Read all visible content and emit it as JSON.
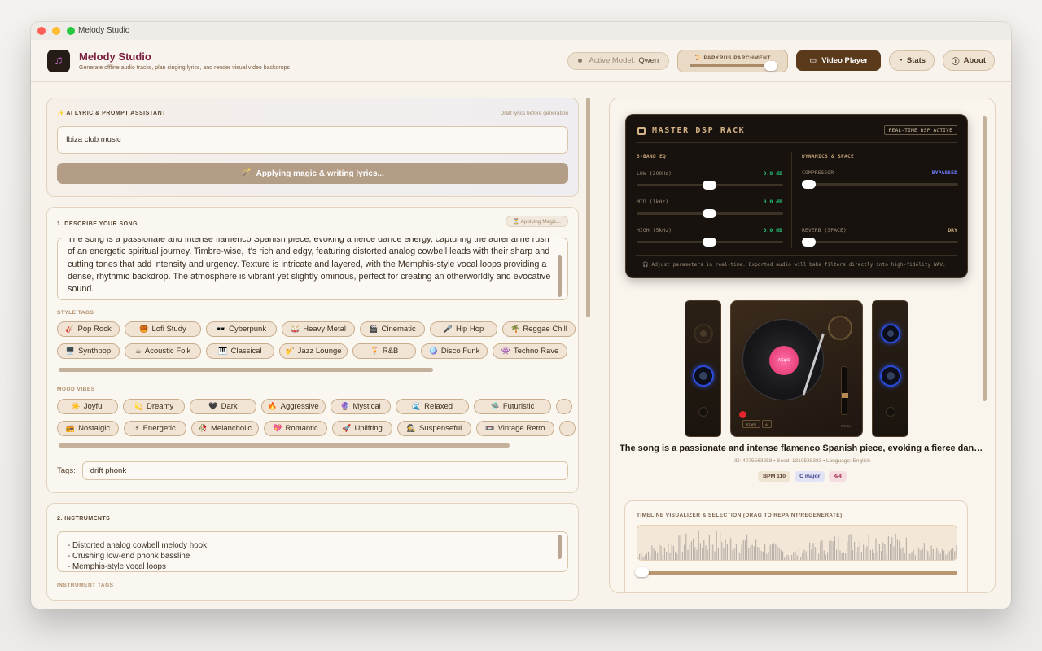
{
  "window": {
    "title": "Melody Studio"
  },
  "header": {
    "title": "Melody Studio",
    "subtitle": "Generate offline audio tracks, plan singing lyrics, and render visual video backdrops",
    "model_label": "Active Model:",
    "model_value": "Qwen",
    "theme_label": "📜 PAPYRUS PARCHMENT",
    "video_player": "Video Player",
    "stats": "Stats",
    "about": "About"
  },
  "lyric_assistant": {
    "label": "✨ AI LYRIC & PROMPT ASSISTANT",
    "note": "Draft lyrics before generation",
    "prompt_value": "Ibiza club music",
    "button": "Applying magic & writing lyrics..."
  },
  "describe": {
    "label": "1. DESCRIBE YOUR SONG",
    "status": "⏳ Applying Magic...",
    "text": "The song is a passionate and intense flamenco Spanish piece, evoking a fierce dance energy, capturing the adrenaline rush of an energetic spiritual journey. Timbre-wise, it's rich and edgy, featuring distorted analog cowbell leads with their sharp and cutting tones that add intensity and urgency. Texture is intricate and layered, with the Memphis-style vocal loops providing a dense, rhythmic backdrop. The atmosphere is vibrant yet slightly ominous, perfect for creating an otherworldly and evocative sound.",
    "style_label": "STYLE TAGS",
    "style_row1": [
      {
        "icon": "🎸",
        "label": "Pop Rock"
      },
      {
        "icon": "🥮",
        "label": "Lofi Study"
      },
      {
        "icon": "🕶️",
        "label": "Cyberpunk"
      },
      {
        "icon": "🥁",
        "label": "Heavy Metal"
      },
      {
        "icon": "🎬",
        "label": "Cinematic"
      },
      {
        "icon": "🎤",
        "label": "Hip Hop"
      },
      {
        "icon": "🌴",
        "label": "Reggae Chill"
      }
    ],
    "style_row2": [
      {
        "icon": "🖥️",
        "label": "Synthpop"
      },
      {
        "icon": "☕",
        "label": "Acoustic Folk"
      },
      {
        "icon": "🎹",
        "label": "Classical"
      },
      {
        "icon": "🎷",
        "label": "Jazz Lounge"
      },
      {
        "icon": "🍹",
        "label": "R&B"
      },
      {
        "icon": "🪩",
        "label": "Disco Funk"
      },
      {
        "icon": "👾",
        "label": "Techno Rave"
      }
    ],
    "mood_label": "MOOD VIBES",
    "mood_row1": [
      {
        "icon": "☀️",
        "label": "Joyful"
      },
      {
        "icon": "💫",
        "label": "Dreamy"
      },
      {
        "icon": "🖤",
        "label": "Dark"
      },
      {
        "icon": "🔥",
        "label": "Aggressive"
      },
      {
        "icon": "🔮",
        "label": "Mystical"
      },
      {
        "icon": "🌊",
        "label": "Relaxed"
      },
      {
        "icon": "🛸",
        "label": "Futuristic"
      },
      {
        "icon": "",
        "label": ""
      }
    ],
    "mood_row2": [
      {
        "icon": "📻",
        "label": "Nostalgic"
      },
      {
        "icon": "⚡",
        "label": "Energetic"
      },
      {
        "icon": "🥀",
        "label": "Melancholic"
      },
      {
        "icon": "💖",
        "label": "Romantic"
      },
      {
        "icon": "🚀",
        "label": "Uplifting"
      },
      {
        "icon": "🕵️",
        "label": "Suspenseful"
      },
      {
        "icon": "📼",
        "label": "Vintage Retro"
      },
      {
        "icon": "",
        "label": ""
      }
    ],
    "tags_label": "Tags:",
    "tags_value": "drift phonk"
  },
  "instruments": {
    "label": "2. INSTRUMENTS",
    "lines": [
      "- Distorted analog cowbell melody hook",
      "- Crushing low-end phonk bassline",
      "- Memphis-style vocal loops"
    ],
    "tags_label": "INSTRUMENT TAGS"
  },
  "dsp": {
    "title": "MASTER DSP RACK",
    "badge": "REAL-TIME DSP ACTIVE",
    "eq_label": "3-BAND EQ",
    "eq": [
      {
        "name": "LOW (200Hz)",
        "value": "0.0 dB",
        "level": 0.5
      },
      {
        "name": "MID (1kHz)",
        "value": "0.0 dB",
        "level": 0.5
      },
      {
        "name": "HIGH (5kHz)",
        "value": "0.0 dB",
        "level": 0.5
      }
    ],
    "dyn_label": "DYNAMICS & SPACE",
    "compressor": {
      "name": "COMPRESSOR",
      "value": "BYPASSED",
      "level": 0
    },
    "reverb": {
      "name": "REVERB (SPACE)",
      "value": "DRY",
      "level": 0
    },
    "footer": "🎧 Adjust parameters in real-time. Exported audio will bake filters directly into high-fidelity WAV.",
    "colors": {
      "eq_value": "#27c27a",
      "bypassed": "#6d7dff",
      "dry": "#d8b783"
    }
  },
  "turntable": {
    "start": "START",
    "ai": "AI",
    "pitch": "PITCH",
    "record_label": "AC◉S"
  },
  "song": {
    "title": "The song is a passionate and intense flamenco Spanish piece, evoking a fierce dance energy",
    "meta": "ID: 4075563258 • Seed: 1310538383 • Language: English",
    "bpm": "BPM 110",
    "key": "C major",
    "time_sig": "4/4"
  },
  "timeline": {
    "label": "TIMELINE VISUALIZER & SELECTION (DRAG TO REPAINT/REGENERATE)",
    "selection_start": 0
  }
}
